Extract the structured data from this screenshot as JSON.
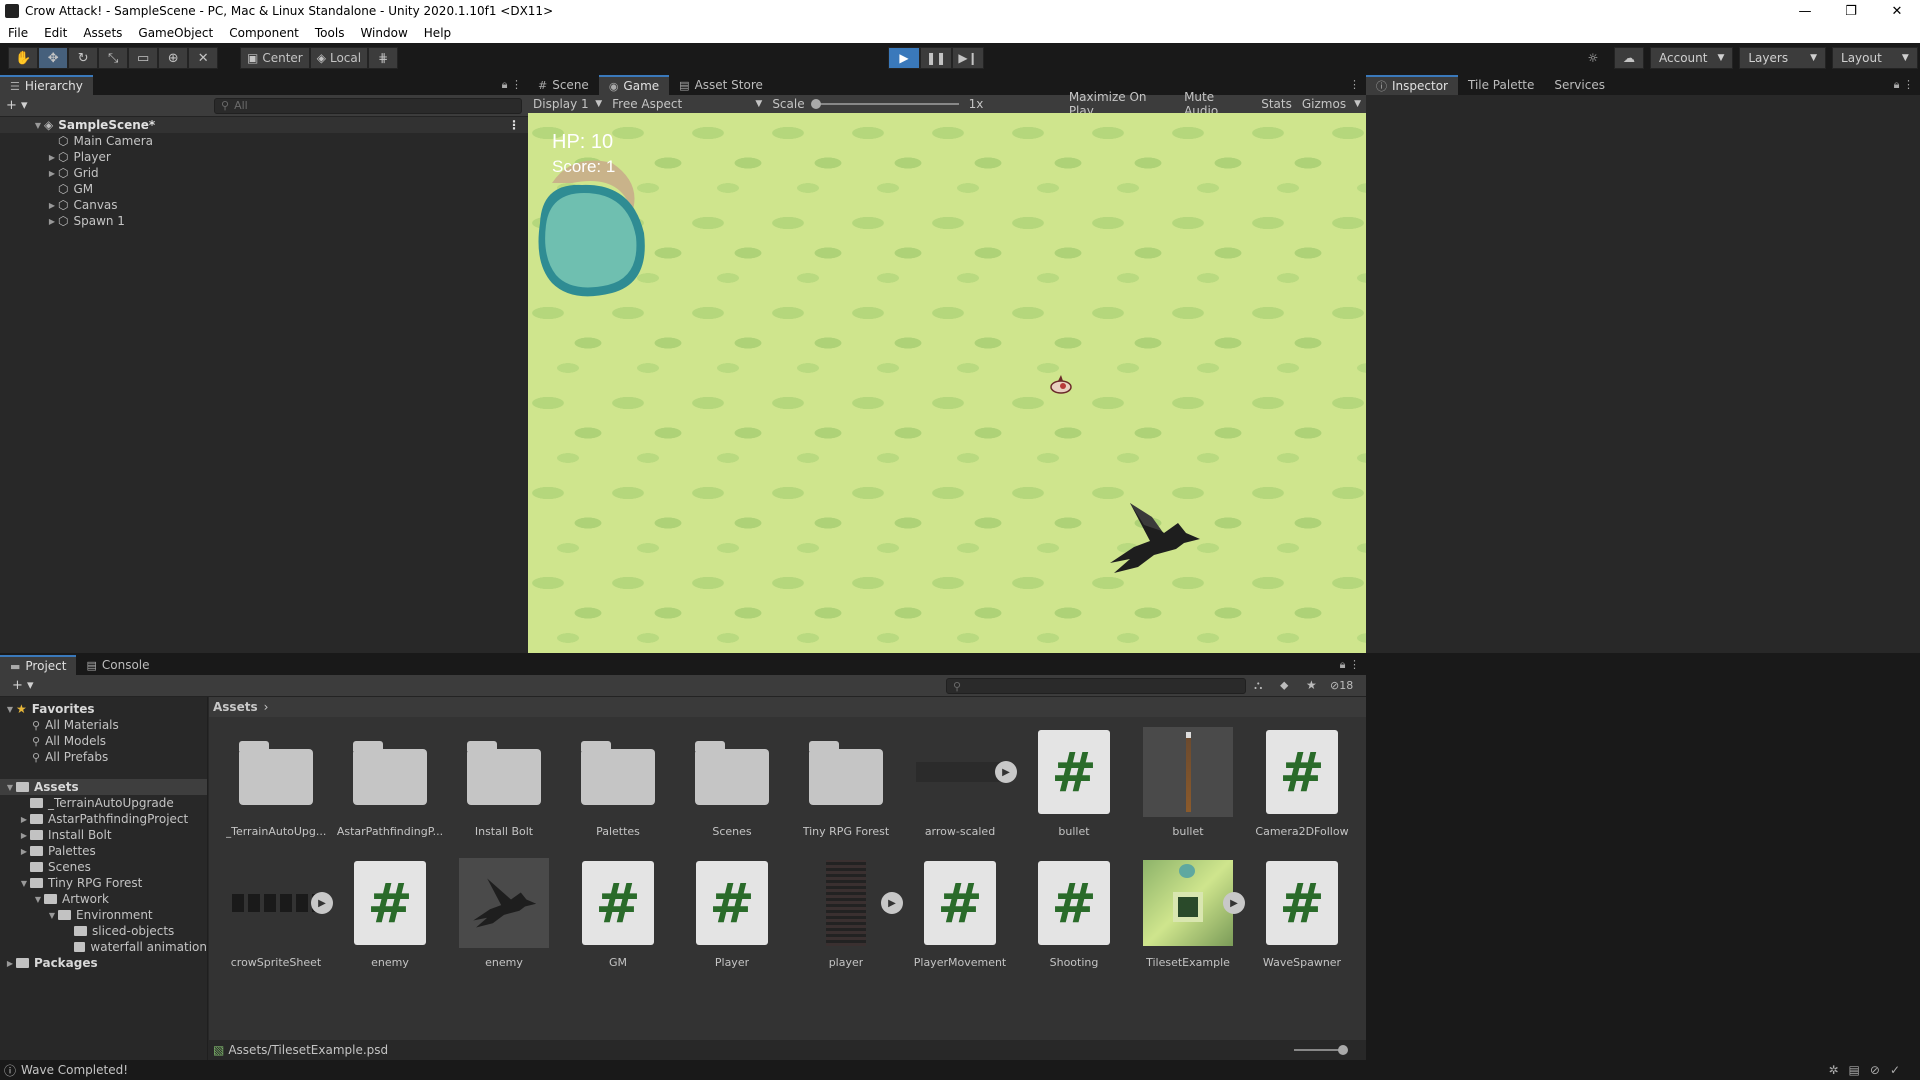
{
  "window": {
    "title": "Crow Attack! - SampleScene - PC, Mac & Linux Standalone - Unity 2020.1.10f1 <DX11>",
    "min": "—",
    "max": "❐",
    "close": "✕"
  },
  "menu": [
    "File",
    "Edit",
    "Assets",
    "GameObject",
    "Component",
    "Tools",
    "Window",
    "Help"
  ],
  "toolbar": {
    "pivot": "Center",
    "space": "Local",
    "account": "Account",
    "layers": "Layers",
    "layout": "Layout"
  },
  "hierarchy": {
    "tab": "Hierarchy",
    "search_placeholder": "All",
    "scene": "SampleScene*",
    "objects": [
      "Main Camera",
      "Player",
      "Grid",
      "GM",
      "Canvas",
      "Spawn 1"
    ]
  },
  "center_tabs": [
    "Scene",
    "Game",
    "Asset Store"
  ],
  "game_toolbar": {
    "display": "Display 1",
    "aspect": "Free Aspect",
    "scale_label": "Scale",
    "scale_value": "1x",
    "maximize": "Maximize On Play",
    "mute": "Mute Audio",
    "stats": "Stats",
    "gizmos": "Gizmos"
  },
  "hud": {
    "hp": "HP: 10",
    "score": "Score: 1"
  },
  "right_tabs": [
    "Inspector",
    "Tile Palette",
    "Services"
  ],
  "project": {
    "tabs": [
      "Project",
      "Console"
    ],
    "hidden_count": "18",
    "breadcrumb": "Assets",
    "favorites": {
      "title": "Favorites",
      "items": [
        "All Materials",
        "All Models",
        "All Prefabs"
      ]
    },
    "assets_root": "Assets",
    "tree": [
      "_TerrainAutoUpgrade",
      "AstarPathfindingProject",
      "Install Bolt",
      "Palettes",
      "Scenes",
      "Tiny RPG Forest",
      "Artwork",
      "Environment",
      "sliced-objects",
      "waterfall animation"
    ],
    "packages": "Packages",
    "assets": [
      {
        "label": "_TerrainAutoUpg...",
        "kind": "folder"
      },
      {
        "label": "AstarPathfindingP...",
        "kind": "folder"
      },
      {
        "label": "Install Bolt",
        "kind": "folder"
      },
      {
        "label": "Palettes",
        "kind": "folder"
      },
      {
        "label": "Scenes",
        "kind": "folder"
      },
      {
        "label": "Tiny RPG Forest",
        "kind": "folder"
      },
      {
        "label": "arrow-scaled",
        "kind": "sheet"
      },
      {
        "label": "bullet",
        "kind": "script"
      },
      {
        "label": "bullet",
        "kind": "sprite"
      },
      {
        "label": "Camera2DFollow",
        "kind": "script"
      },
      {
        "label": "crowSpriteSheet",
        "kind": "sheet"
      },
      {
        "label": "enemy",
        "kind": "script"
      },
      {
        "label": "enemy",
        "kind": "crow"
      },
      {
        "label": "GM",
        "kind": "script"
      },
      {
        "label": "Player",
        "kind": "script"
      },
      {
        "label": "player",
        "kind": "sheet"
      },
      {
        "label": "PlayerMovement",
        "kind": "script"
      },
      {
        "label": "Shooting",
        "kind": "script"
      },
      {
        "label": "TilesetExample",
        "kind": "tileset"
      },
      {
        "label": "WaveSpawner",
        "kind": "script"
      }
    ],
    "script_glyph": "#",
    "selected_path": "Assets/TilesetExample.psd"
  },
  "status": "Wave Completed!",
  "colors": {
    "accent": "#3a79bb",
    "grass": "#cfe58d",
    "water": "#6fbfb0"
  }
}
